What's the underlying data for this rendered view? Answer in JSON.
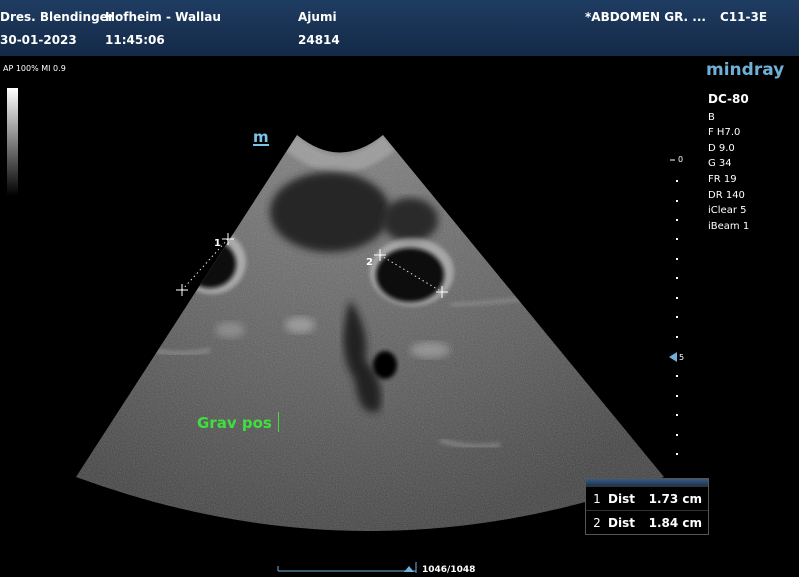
{
  "header": {
    "clinic": "Dres. Blendinger",
    "location": "Hofheim - Wallau",
    "patient": "Ajumi",
    "exam": "*ABDOMEN GR. ...",
    "probe": "C11-3E",
    "date": "30-01-2023",
    "time": "11:45:06",
    "patient_id": "24814"
  },
  "ap_mi": "AP 100%  MI 0.9",
  "brand": "mindray",
  "imaging_params": [
    "DC-80",
    "B",
    "F H7.0",
    "D 9.0",
    "G 34",
    "FR 19",
    "DR 140",
    "iClear 5",
    "iBeam 1"
  ],
  "depth_scale": {
    "top": "0",
    "focus": "5"
  },
  "orientation_marker": "m",
  "annotation": "Grav pos",
  "caliper_labels": [
    "1",
    "2"
  ],
  "measurements": [
    {
      "index": "1",
      "label": "Dist",
      "value": "1.73 cm"
    },
    {
      "index": "2",
      "label": "Dist",
      "value": "1.84 cm"
    }
  ],
  "cine_frame": "1046/1048",
  "colors": {
    "header": "#1f3c62",
    "annotation": "#3ee03e",
    "brand": "#6fb0d8"
  }
}
